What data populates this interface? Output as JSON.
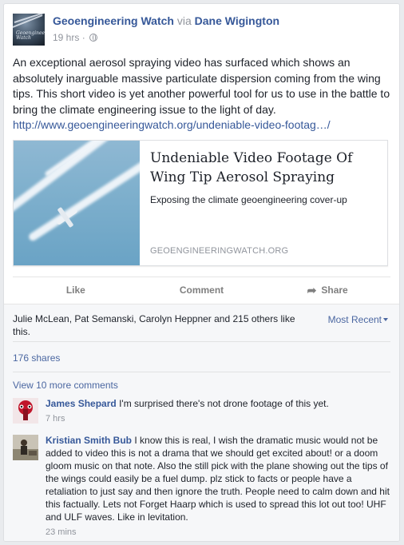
{
  "post": {
    "page_name": "Geoengineering Watch",
    "via_text": "via",
    "author": "Dane Wigington",
    "time": "19 hrs",
    "dot": "·",
    "avatar_text": "Geoengineering Watch",
    "body": "An exceptional aerosol spraying video has surfaced which shows an absolutely inarguable massive particulate dispersion coming from the wing tips. This short video is yet another powerful tool for us to use in the battle to bring the climate engineering issue to the light of day.",
    "link": "http://www.geoengineeringwatch.org/undeniable-video-footag…/"
  },
  "link_card": {
    "title": "Undeniable Video Footage Of Wing Tip Aerosol Spraying",
    "description": "Exposing the climate geoengineering cover-up",
    "domain": "GEOENGINEERINGWATCH.ORG"
  },
  "actions": {
    "like": "Like",
    "comment": "Comment",
    "share": "Share"
  },
  "ufi": {
    "likes": "Julie McLean, Pat Semanski, Carolyn Heppner and 215 others like this.",
    "sort": "Most Recent",
    "shares": "176 shares",
    "view_more": "View 10 more comments"
  },
  "comments": [
    {
      "name": "James Shepard",
      "text": "I'm surprised there's not drone footage of this yet.",
      "time": "7 hrs"
    },
    {
      "name": "Kristian Smith Bub",
      "text": "I know this is real, I wish the dramatic music would not be added to video this is not a drama that we should get excited about! or a doom gloom music on that note. Also the still pick with the plane showing out the tips of the wings could easily be a fuel dump. plz stick to facts or people have a retaliation to just say and then ignore the truth. People need to calm down and hit this factually. Lets not Forget Haarp which is used to spread this lot out too! UHF and ULF waves. Like in levitation.",
      "time": "23 mins"
    }
  ],
  "colors": {
    "link": "#365899",
    "meta": "#90949c",
    "ufi_bg": "#f6f7f9"
  }
}
